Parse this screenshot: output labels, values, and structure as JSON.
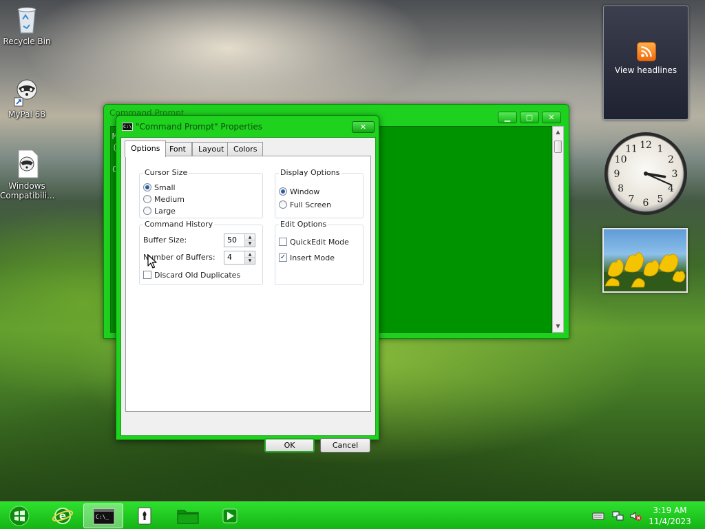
{
  "desktop": {
    "icons": [
      {
        "label": "Recycle Bin",
        "icon": "recycle-bin-icon"
      },
      {
        "label": "MyPal 68",
        "icon": "raccoon-shortcut-icon"
      },
      {
        "label": "Windows Compatibili...",
        "icon": "raccoon-document-icon"
      }
    ]
  },
  "gadgets": {
    "rss": {
      "label": "View headlines",
      "icon": "rss-feed-icon"
    },
    "clock": {
      "hour": 3,
      "minute": 19,
      "numbers": [
        "12",
        "1",
        "2",
        "3",
        "4",
        "5",
        "6",
        "7",
        "8",
        "9",
        "10",
        "11"
      ]
    },
    "slideshow": {
      "icon": "tulips-photo"
    }
  },
  "console_window": {
    "title": "Command Prompt",
    "visible_text": "M\n(\n\nC",
    "buttons": {
      "minimize": "▁",
      "maximize": "▢",
      "close": "✕"
    }
  },
  "properties_dialog": {
    "title": "\"Command Prompt\" Properties",
    "close_label": "✕",
    "tabs": [
      {
        "label": "Options",
        "active": true
      },
      {
        "label": "Font",
        "active": false
      },
      {
        "label": "Layout",
        "active": false
      },
      {
        "label": "Colors",
        "active": false
      }
    ],
    "cursor_size": {
      "label": "Cursor Size",
      "options": [
        {
          "label": "Small",
          "selected": true
        },
        {
          "label": "Medium",
          "selected": false
        },
        {
          "label": "Large",
          "selected": false
        }
      ]
    },
    "display_options": {
      "label": "Display Options",
      "options": [
        {
          "label": "Window",
          "selected": true
        },
        {
          "label": "Full Screen",
          "selected": false
        }
      ]
    },
    "command_history": {
      "label": "Command History",
      "buffer_size_label": "Buffer Size:",
      "buffer_size_value": "50",
      "num_buffers_label": "Number of Buffers:",
      "num_buffers_value": "4",
      "discard_label": "Discard Old Duplicates",
      "discard_checked": false
    },
    "edit_options": {
      "label": "Edit Options",
      "quickedit_label": "QuickEdit Mode",
      "quickedit_checked": false,
      "insert_label": "Insert Mode",
      "insert_checked": true
    },
    "ok_label": "OK",
    "cancel_label": "Cancel"
  },
  "taskbar": {
    "items": [
      {
        "icon": "start-orb-icon"
      },
      {
        "icon": "internet-explorer-icon"
      },
      {
        "icon": "command-prompt-icon",
        "active": true
      },
      {
        "icon": "solitaire-icon"
      },
      {
        "icon": "file-explorer-icon"
      },
      {
        "icon": "media-player-icon"
      }
    ],
    "tray": [
      "keyboard-icon",
      "network-icon",
      "volume-muted-icon"
    ],
    "time": "3:19 AM",
    "date": "11/4/2023"
  },
  "colors": {
    "window_frame": "#1ed21e",
    "console_background": "#009300",
    "taskbar": "#1fc81f",
    "rss_orange": "#f07a1a"
  }
}
